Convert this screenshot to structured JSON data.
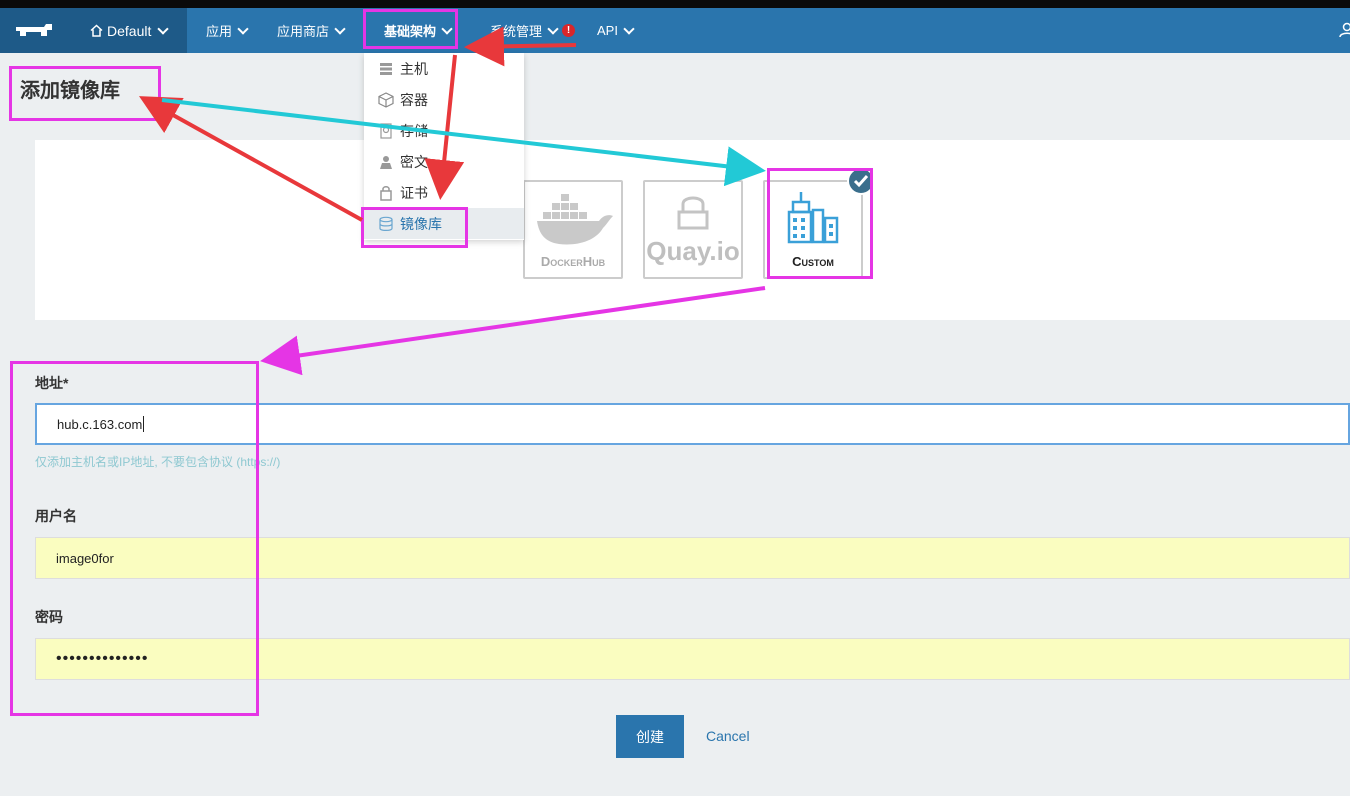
{
  "nav": {
    "env_label": "Default",
    "items": [
      {
        "label": "应用"
      },
      {
        "label": "应用商店"
      },
      {
        "label": "基础架构"
      },
      {
        "label": "系统管理"
      },
      {
        "label": "API"
      }
    ],
    "alert_glyph": "!"
  },
  "dropdown": {
    "items": [
      {
        "label": "主机",
        "icon": "host-icon"
      },
      {
        "label": "容器",
        "icon": "container-icon"
      },
      {
        "label": "存储",
        "icon": "storage-icon"
      },
      {
        "label": "密文",
        "icon": "secret-icon"
      },
      {
        "label": "证书",
        "icon": "certificate-icon"
      },
      {
        "label": "镜像库",
        "icon": "registry-icon"
      }
    ]
  },
  "page": {
    "title": "添加镜像库"
  },
  "registry_types": [
    {
      "label": "DockerHub",
      "selected": false
    },
    {
      "label": "Quay.io",
      "selected": false
    },
    {
      "label": "Custom",
      "selected": true
    }
  ],
  "form": {
    "address_label": "地址*",
    "address_value": "hub.c.163.com",
    "address_hint": "仅添加主机名或IP地址, 不要包含协议 (https://)",
    "username_label": "用户名",
    "username_value": "image0for",
    "password_label": "密码",
    "password_value": "••••••••••••••"
  },
  "buttons": {
    "create": "创建",
    "cancel": "Cancel"
  },
  "colors": {
    "nav_bg": "#2a75ad",
    "annotation": "#e535e5",
    "arrow_red": "#e8383b",
    "arrow_cyan": "#22c9d6"
  }
}
